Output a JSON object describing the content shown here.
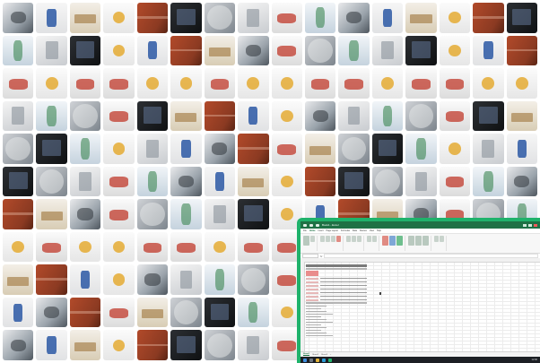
{
  "mosaic": {
    "rows": 11,
    "cols": 16,
    "thumbnail_icons": [
      "faucet-icon",
      "pipe-fitting-icon",
      "wall-panel-icon",
      "valve-icon",
      "chair-icon",
      "brick-wall-icon",
      "radiator-icon",
      "sink-icon",
      "lamp-icon",
      "cabinet-icon",
      "door-icon",
      "window-icon",
      "pump-icon",
      "bracket-icon",
      "tile-icon",
      "boiler-icon"
    ]
  },
  "excel": {
    "title": "Book1 - Excel",
    "menu": [
      "File",
      "Home",
      "Insert",
      "Page Layout",
      "Formulas",
      "Data",
      "Review",
      "View",
      "Help"
    ],
    "active_menu": "Home",
    "formula_symbol": "fx",
    "sheet_tabs": [
      "Sheet1",
      "Sheet2",
      "Sheet3"
    ],
    "active_tab": "Sheet1",
    "taskbar_time": "12:00",
    "accent_color": "#1e7145",
    "frame_color": "#1fb26b"
  }
}
